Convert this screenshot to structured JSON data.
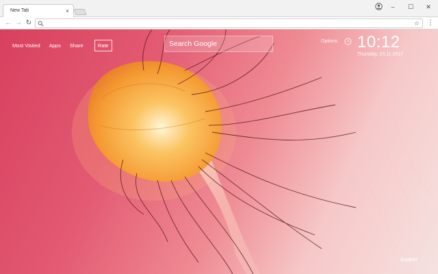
{
  "browser": {
    "tab_title": "New Tab",
    "tab_close": "×",
    "window_controls": {
      "minimize": "–",
      "maximize": "☐",
      "close": "✕"
    },
    "omnibox_value": ""
  },
  "page": {
    "nav": [
      {
        "label": "Most Visited"
      },
      {
        "label": "Apps"
      },
      {
        "label": "Share"
      },
      {
        "label": "Rate"
      }
    ],
    "search": {
      "placeholder": "Search Google"
    },
    "options_label": "Options",
    "clock": {
      "time": "10:12",
      "date": "Thursday, 23.11.2017"
    },
    "support_label": "Support"
  },
  "colors": {
    "background_left": "#d8405e",
    "background_right": "#f5e2e0",
    "jellyfish_bell": "#f7a23a",
    "tentacle": "#5a1a1a"
  }
}
